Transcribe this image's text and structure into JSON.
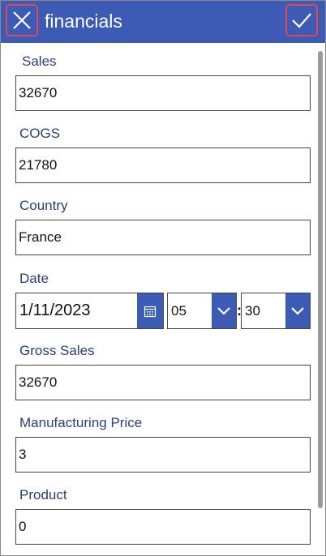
{
  "header": {
    "title": "financials",
    "close_icon": "close-icon",
    "submit_icon": "checkmark-icon",
    "background_color": "#3b5bb5",
    "highlight_color": "#e0455a"
  },
  "form": {
    "sales": {
      "label": "Sales",
      "value": "32670"
    },
    "cogs": {
      "label": "COGS",
      "value": "21780"
    },
    "country": {
      "label": "Country",
      "value": "France"
    },
    "date": {
      "label": "Date",
      "value": "1/11/2023",
      "hour": "05",
      "minute": "30",
      "separator": ":",
      "calendar_icon": "calendar-icon",
      "dropdown_icon": "chevron-down-icon"
    },
    "gross_sales": {
      "label": "Gross Sales",
      "value": "32670"
    },
    "manufacturing_price": {
      "label": "Manufacturing Price",
      "value": "3"
    },
    "product": {
      "label": "Product",
      "value": "0"
    }
  }
}
